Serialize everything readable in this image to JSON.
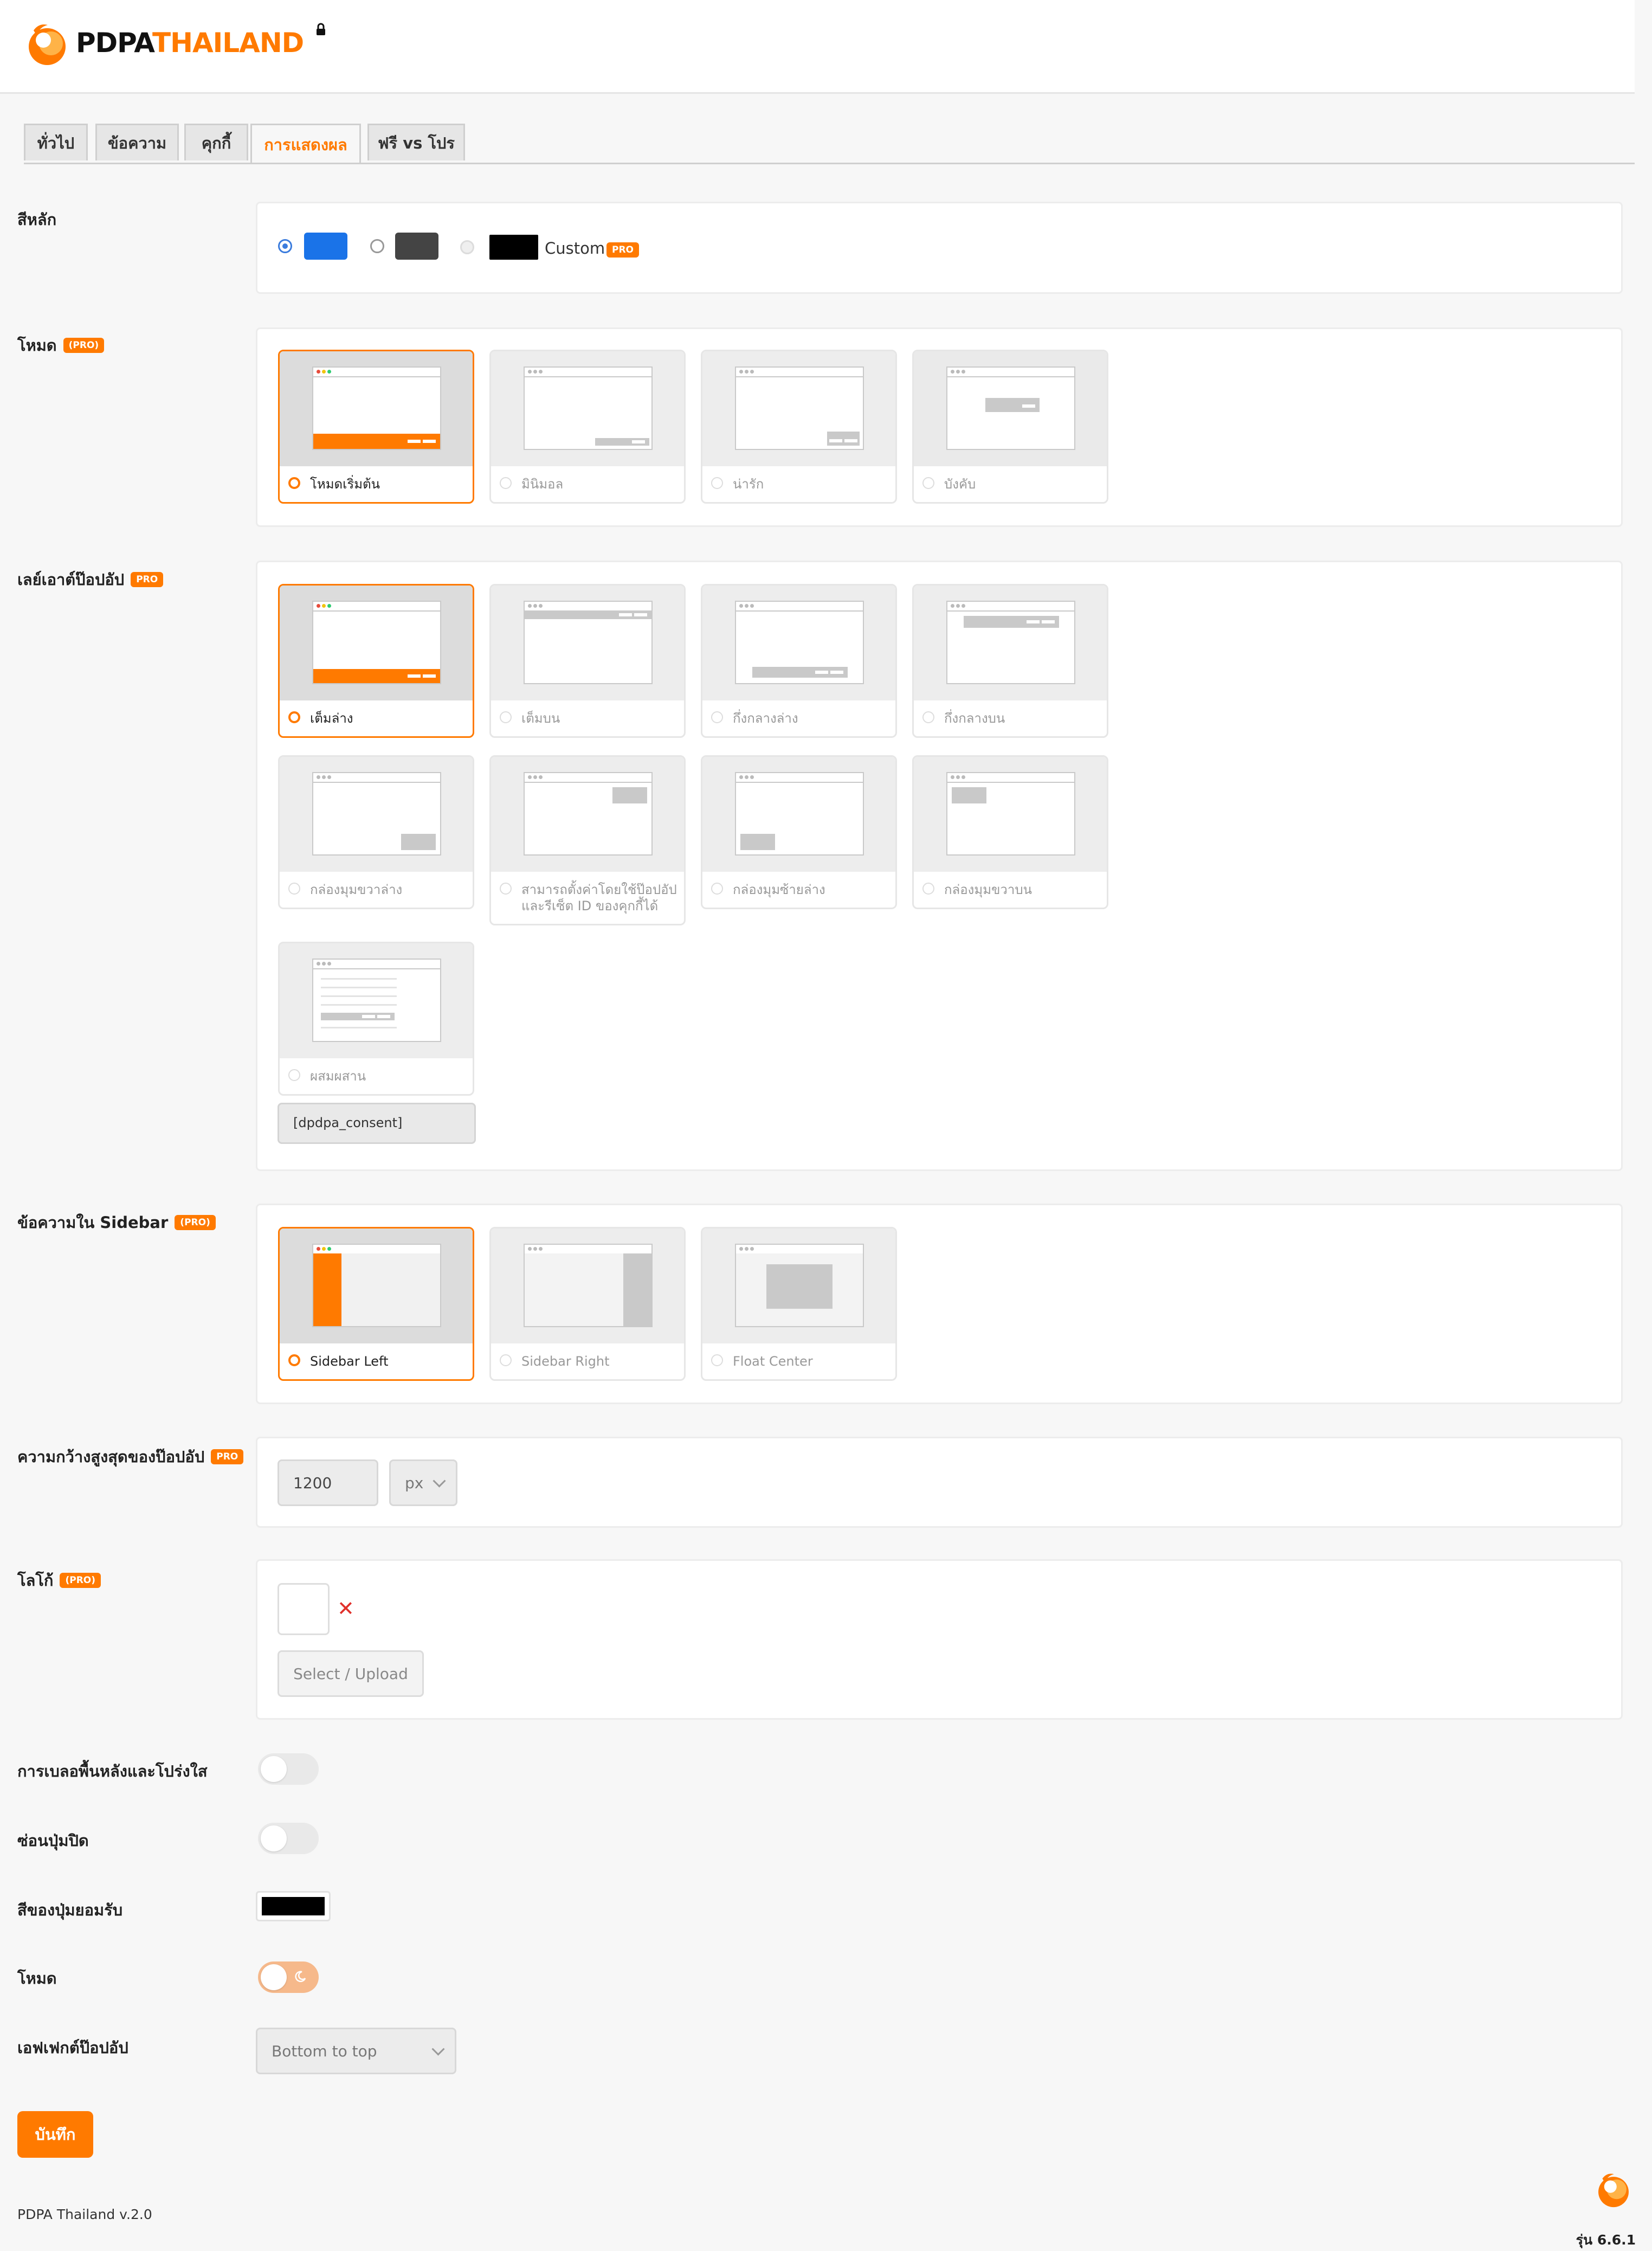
{
  "app": {
    "logo_part1": "PDPA",
    "logo_part2": "THAILAND",
    "brand_color": "#ff7a00"
  },
  "tabs": [
    {
      "label": "ทั่วไป",
      "active": false
    },
    {
      "label": "ข้อความ",
      "active": false
    },
    {
      "label": "คุกกี้",
      "active": false
    },
    {
      "label": "การแสดงผล",
      "active": true
    },
    {
      "label": "ฟรี vs โปร",
      "active": false
    }
  ],
  "pro_badge": "PRO",
  "pro_badge_paren": "(PRO)",
  "primary_color": {
    "label": "สีหลัก",
    "options": [
      {
        "color": "#1a73e8",
        "selected": true
      },
      {
        "color": "#444444",
        "selected": false
      },
      {
        "color": "#000000",
        "selected": false,
        "disabled": true,
        "label": "Custom"
      }
    ]
  },
  "mode": {
    "label": "โหมด",
    "options": [
      {
        "label": "โหมดเริ่มต้น",
        "selected": true
      },
      {
        "label": "มินิมอล",
        "selected": false
      },
      {
        "label": "น่ารัก",
        "selected": false
      },
      {
        "label": "บังคับ",
        "selected": false
      }
    ]
  },
  "layout": {
    "label": "เลย์เอาต์ป๊อปอัป",
    "options": [
      {
        "label": "เต็มล่าง",
        "selected": true
      },
      {
        "label": "เต็มบน",
        "selected": false
      },
      {
        "label": "กึ่งกลางล่าง",
        "selected": false
      },
      {
        "label": "กึ่งกลางบน",
        "selected": false
      },
      {
        "label": "กล่องมุมขวาล่าง",
        "selected": false
      },
      {
        "label": "สามารถตั้งค่าโดยใช้ป๊อปอัปและรีเซ็ต ID ของคุกกี้ได้",
        "selected": false
      },
      {
        "label": "กล่องมุมซ้ายล่าง",
        "selected": false
      },
      {
        "label": "กล่องมุมขวาบน",
        "selected": false
      },
      {
        "label": "ผสมผสาน",
        "selected": false
      }
    ],
    "shortcode": "[dpdpa_consent]"
  },
  "sidebar": {
    "label": "ข้อความใน Sidebar",
    "options": [
      {
        "label": "Sidebar Left",
        "selected": true
      },
      {
        "label": "Sidebar Right",
        "selected": false
      },
      {
        "label": "Float Center",
        "selected": false
      }
    ]
  },
  "max_width": {
    "label": "ความกว้างสูงสุดของป๊อปอัป",
    "value": "1200",
    "unit": "px"
  },
  "logo_setting": {
    "label": "โลโก้",
    "upload_label": "Select / Upload",
    "remove_symbol": "✕"
  },
  "blur_bg": {
    "label": "การเบลอพื้นหลังและโปร่งใส",
    "enabled": false
  },
  "hide_close": {
    "label": "ซ่อนปุ่มปิด",
    "enabled": false
  },
  "accept_color": {
    "label": "สีของปุ่มยอมรับ",
    "color": "#000000"
  },
  "dark_mode": {
    "label": "โหมด",
    "enabled": true
  },
  "popup_effect": {
    "label": "เอฟเฟกต์ป๊อปอัป",
    "value": "Bottom to top"
  },
  "save_label": "บันทึก",
  "footer_text": "PDPA Thailand v.2.0",
  "version_text": "รุ่น 6.6.1"
}
